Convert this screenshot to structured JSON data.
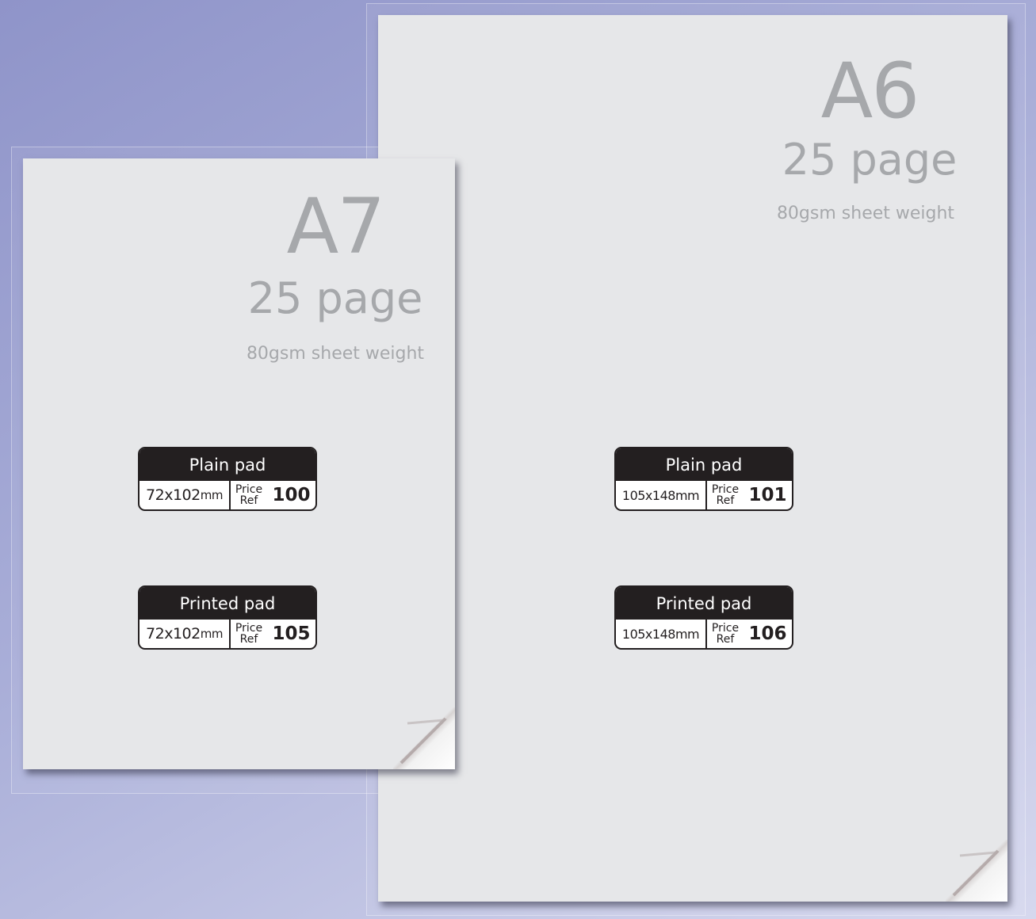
{
  "sheets": [
    {
      "size_code": "A7",
      "pages": "25 page",
      "weight": "80gsm sheet weight",
      "labels": [
        {
          "title": "Plain pad",
          "dims": "72x102",
          "unit": "mm",
          "price_word": "Price",
          "ref_word": "Ref",
          "ref": "100"
        },
        {
          "title": "Printed pad",
          "dims": "72x102",
          "unit": "mm",
          "price_word": "Price",
          "ref_word": "Ref",
          "ref": "105"
        }
      ]
    },
    {
      "size_code": "A6",
      "pages": "25 page",
      "weight": "80gsm sheet weight",
      "labels": [
        {
          "title": "Plain pad",
          "dims": "105x148",
          "unit": "mm",
          "price_word": "Price",
          "ref_word": "Ref",
          "ref": "101"
        },
        {
          "title": "Printed pad",
          "dims": "105x148",
          "unit": "mm",
          "price_word": "Price",
          "ref_word": "Ref",
          "ref": "106"
        }
      ]
    }
  ],
  "colors": {
    "sheet": "#e6e7e9",
    "text_grey": "#a6a8ab",
    "label_dark": "#231f20"
  }
}
